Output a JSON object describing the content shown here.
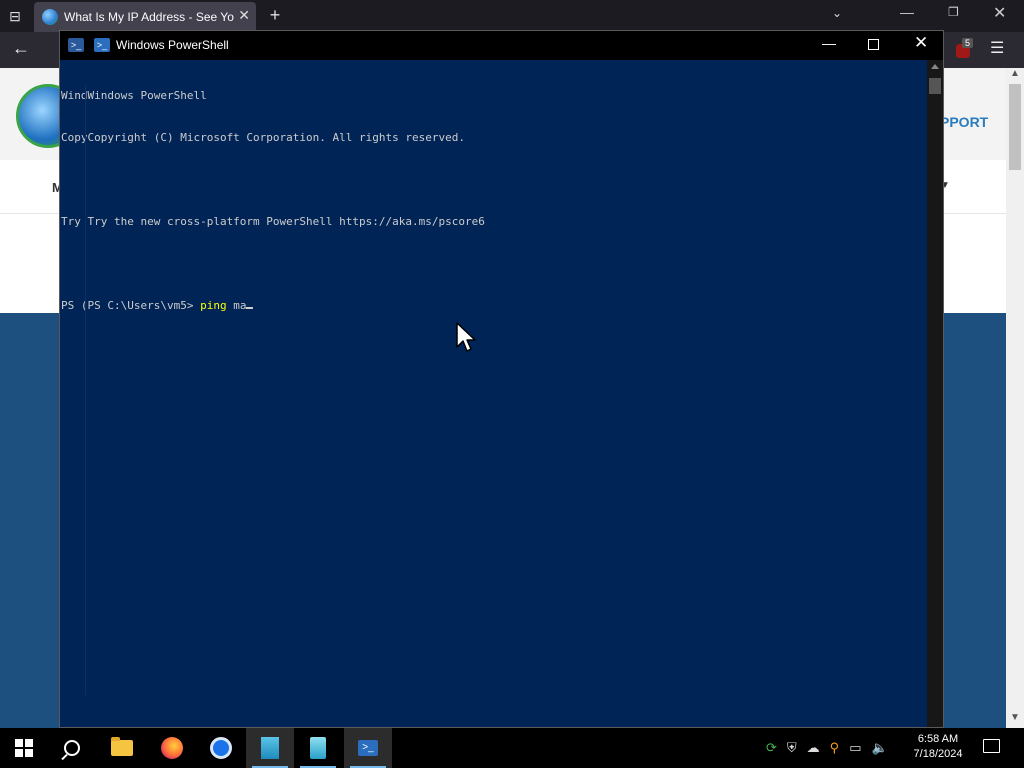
{
  "browser": {
    "tab_title": "What Is My IP Address - See Your",
    "extension_badge": "5"
  },
  "webpage": {
    "nav_support": "PPORT",
    "menu_letter": "M"
  },
  "powershell": {
    "window_title": "Windows PowerShell",
    "lines": [
      "WindWindows PowerShell",
      "CopyCopyright (C) Microsoft Corporation. All rights reserved.",
      "",
      "Try Try the new cross-platform PowerShell https://aka.ms/pscore6",
      ""
    ],
    "prompt": "PS (PS C:\\Users\\vm5> ",
    "command": "ping",
    "argument": "ma"
  },
  "taskbar": {
    "time": "6:58 AM",
    "date": "7/18/2024",
    "pinned": [
      "start",
      "search",
      "file-explorer",
      "firefox",
      "chrome",
      "app-building",
      "app-building-2",
      "powershell"
    ],
    "active": "powershell"
  }
}
